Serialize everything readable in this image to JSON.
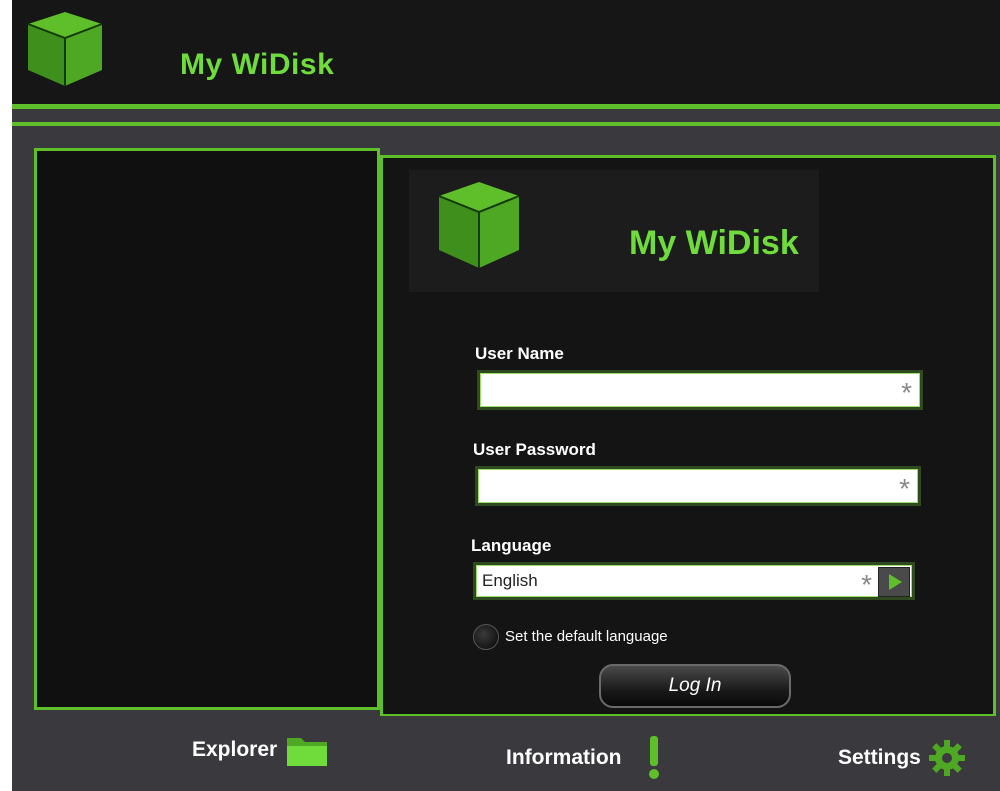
{
  "app": {
    "title": "My WiDisk",
    "accent_color": "#5fbf2a",
    "title_color": "#6fdc3c",
    "logo_icon": "cube-logo-icon"
  },
  "login": {
    "brand_title": "My WiDisk",
    "username_label": "User Name",
    "username_value": "",
    "password_label": "User Password",
    "password_value": "",
    "required_marker": "*",
    "language_label": "Language",
    "language_value": "English",
    "default_language_label": "Set the default language",
    "login_button": "Log In"
  },
  "footer": {
    "items": [
      {
        "label": "Explorer",
        "icon": "folder-icon"
      },
      {
        "label": "Information",
        "icon": "exclamation-icon"
      },
      {
        "label": "Settings",
        "icon": "gear-icon"
      }
    ]
  }
}
